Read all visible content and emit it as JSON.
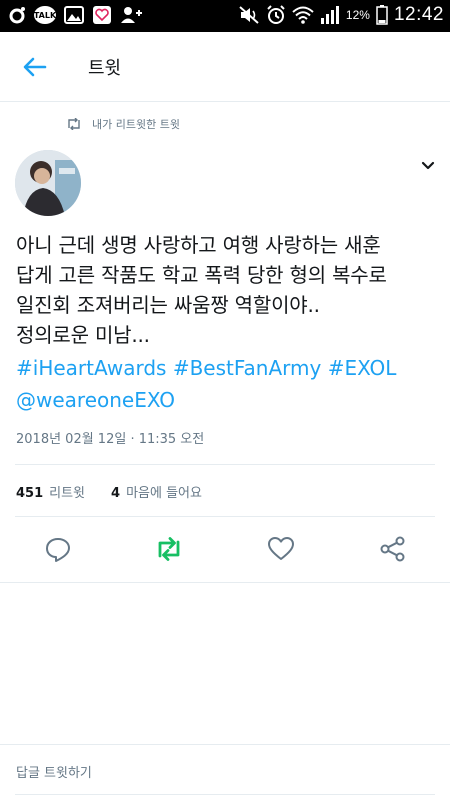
{
  "status_bar": {
    "talk_label": "TALK",
    "battery_pct": "12%",
    "time": "12:42"
  },
  "header": {
    "title": "트윗"
  },
  "retweet_context": "내가 리트윗한 트윗",
  "tweet": {
    "lines": [
      "아니 근데 생명 사랑하고 여행 사랑하는 새훈",
      "답게 고른 작품도 학교 폭력 당한 형의 복수로",
      "일진회 조져버리는 싸움짱 역할이야..",
      "정의로운 미남..."
    ],
    "hashtags": [
      "#iHeartAwards",
      "#BestFanArmy",
      "#EXOL"
    ],
    "mention": "@weareoneEXO",
    "timestamp": "2018년 02월 12일 · 11:35 오전"
  },
  "stats": {
    "retweets_count": "451",
    "retweets_label": "리트윗",
    "likes_count": "4",
    "likes_label": "마음에 들어요"
  },
  "reply": {
    "placeholder": "답글 트윗하기"
  },
  "colors": {
    "accent": "#1da1f2",
    "retweet_green": "#17bf63",
    "muted": "#657786",
    "text": "#14171a"
  }
}
